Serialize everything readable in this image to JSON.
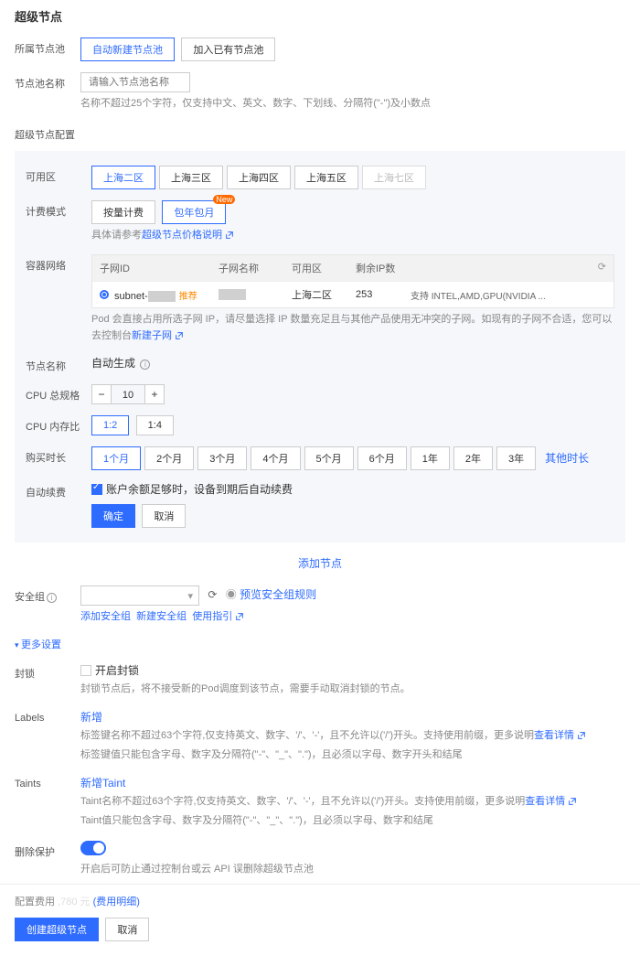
{
  "page_title": "超级节点",
  "pool": {
    "label": "所属节点池",
    "auto_new": "自动新建节点池",
    "join_existing": "加入已有节点池"
  },
  "pool_name": {
    "label": "节点池名称",
    "placeholder": "请输入节点池名称",
    "hint": "名称不超过25个字符，仅支持中文、英文、数字、下划线、分隔符(\"-\")及小数点"
  },
  "config": {
    "label": "超级节点配置",
    "zone": {
      "label": "可用区",
      "opts": [
        "上海二区",
        "上海三区",
        "上海四区",
        "上海五区",
        "上海七区"
      ],
      "disabled_idx": 4
    },
    "billing": {
      "label": "计费模式",
      "opts": [
        "按量计费",
        "包年包月"
      ],
      "badge": "New",
      "hint_prefix": "具体请参考",
      "hint_link": "超级节点价格说明"
    },
    "network": {
      "label": "容器网络",
      "headers": [
        "子网ID",
        "子网名称",
        "可用区",
        "剩余IP数"
      ],
      "row": {
        "id": "subnet-",
        "rec": "推荐",
        "zone": "上海二区",
        "ip": "253",
        "support": "支持 INTEL,AMD,GPU(NVIDIA ..."
      },
      "hint_prefix": "Pod 会直接占用所选子网 IP，请尽量选择 IP 数量充足且与其他产品使用无冲突的子网。如现有的子网不合适，您可以去控制台",
      "hint_link": "新建子网"
    },
    "node_name": {
      "label": "节点名称",
      "value": "自动生成"
    },
    "cpu_total": {
      "label": "CPU 总规格",
      "value": "10"
    },
    "cpu_mem": {
      "label": "CPU 内存比",
      "opts": [
        "1:2",
        "1:4"
      ]
    },
    "duration": {
      "label": "购买时长",
      "opts": [
        "1个月",
        "2个月",
        "3个月",
        "4个月",
        "5个月",
        "6个月",
        "1年",
        "2年",
        "3年"
      ],
      "other": "其他时长"
    },
    "auto_renew": {
      "label": "自动续费",
      "text": "账户余额足够时，设备到期后自动续费"
    },
    "confirm": "确定",
    "cancel": "取消"
  },
  "add_node": "添加节点",
  "sg": {
    "label": "安全组",
    "preview": "预览安全组规则",
    "links": [
      "添加安全组",
      "新建安全组",
      "使用指引"
    ]
  },
  "more": "更多设置",
  "cordon": {
    "label": "封锁",
    "toggle": "开启封锁",
    "hint": "封锁节点后，将不接受新的Pod调度到该节点，需要手动取消封锁的节点。"
  },
  "labels": {
    "label": "Labels",
    "add": "新增",
    "h1_prefix": "标签键名称不超过63个字符,仅支持英文、数字、'/'、'-'，且不允许以('/')开头。支持使用前缀，更多说明",
    "h1_link": "查看详情",
    "h2": "标签键值只能包含字母、数字及分隔符(\"-\"、\"_\"、\".\")，且必须以字母、数字开头和结尾"
  },
  "taints": {
    "label": "Taints",
    "add": "新增Taint",
    "h1_prefix": "Taint名称不超过63个字符,仅支持英文、数字、'/'、'-'，且不允许以('/')开头。支持使用前缀，更多说明",
    "h1_link": "查看详情",
    "h2": "Taint值只能包含字母、数字及分隔符(\"-\"、\"_\"、\".\")，且必须以字母、数字和结尾"
  },
  "protect": {
    "label": "删除保护",
    "hint": "开启后可防止通过控制台或云 API 误删除超级节点池"
  },
  "footer": {
    "cost_label": "配置费用",
    "price_suffix": " ,780 元",
    "detail": "(费用明细)",
    "create": "创建超级节点",
    "cancel": "取消"
  }
}
